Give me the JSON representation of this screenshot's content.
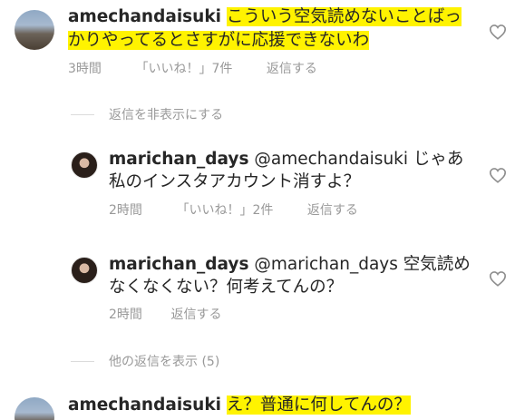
{
  "comments": [
    {
      "username": "amechandaisuki",
      "text_line1": "こういう空気読めないことばっ",
      "text_line2": "かりやってるとさすがに応援できないわ",
      "time": "3時間",
      "likes": "「いいね！」7件",
      "reply": "返信する"
    },
    {
      "username": "marichan_days",
      "mention": "@amechandaisuki",
      "text_line1": "じゃあ",
      "text_line2": "私のインスタアカウント消すよ？",
      "time": "2時間",
      "likes": "「いいね！」2件",
      "reply": "返信する"
    },
    {
      "username": "marichan_days",
      "mention": "@marichan_days",
      "text_line1": "空気読め",
      "text_line2": "なくなくない？何考えてんの？",
      "time": "2時間",
      "reply": "返信する"
    },
    {
      "username": "amechandaisuki",
      "text_line1": "え？普通に何してんの？"
    }
  ],
  "hide_replies": "返信を非表示にする",
  "show_replies": "他の返信を表示 (5)",
  "icons": {
    "like": "heart-outline-icon"
  }
}
